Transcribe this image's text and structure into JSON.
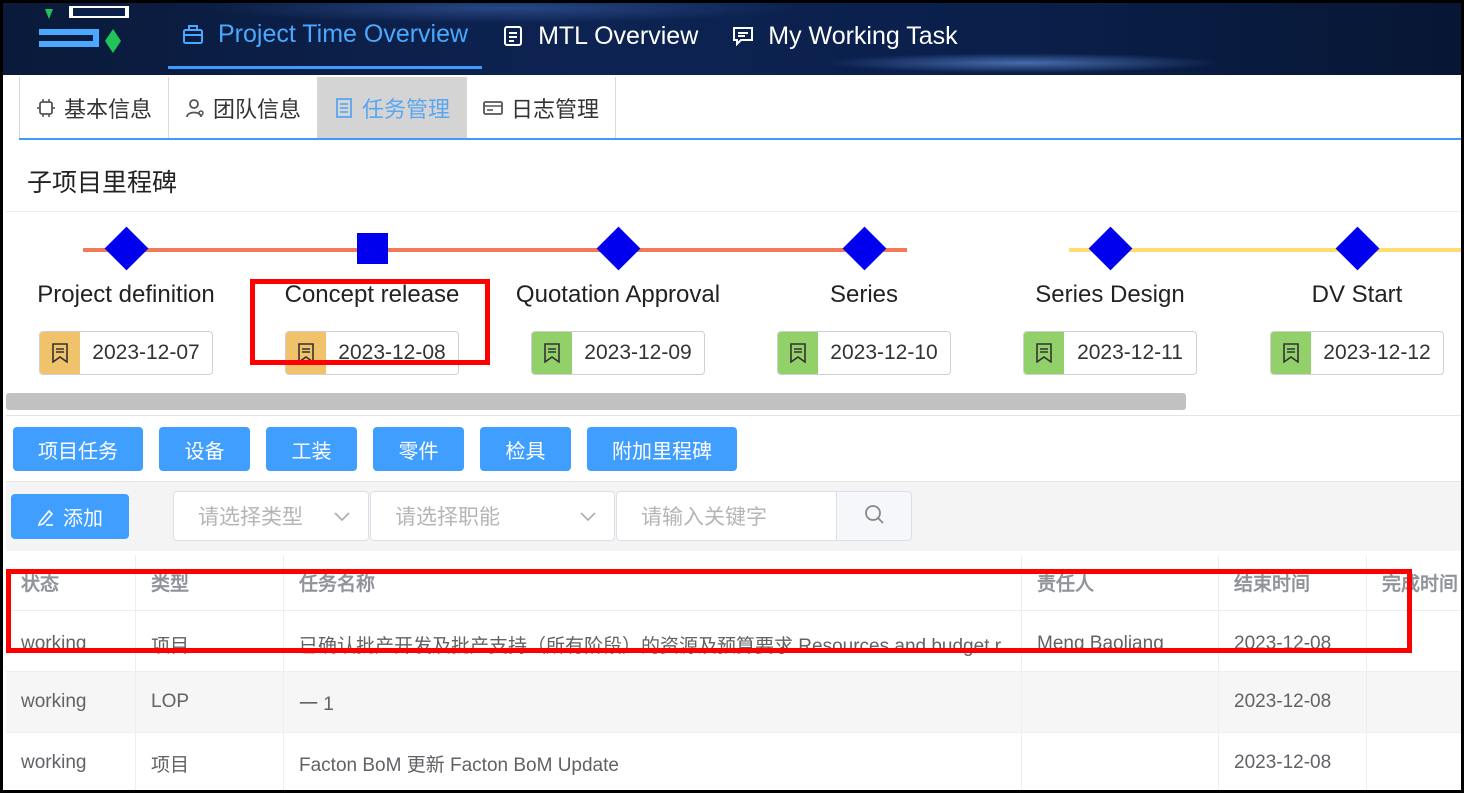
{
  "header": {
    "nav": [
      {
        "label": "Project Time Overview",
        "icon": "briefcase-icon",
        "active": true
      },
      {
        "label": "MTL Overview",
        "icon": "document-icon",
        "active": false
      },
      {
        "label": "My Working Task",
        "icon": "chat-icon",
        "active": false
      }
    ]
  },
  "tabs": [
    {
      "label": "基本信息",
      "icon": "chip-icon",
      "active": false
    },
    {
      "label": "团队信息",
      "icon": "user-icon",
      "active": false
    },
    {
      "label": "任务管理",
      "icon": "tasks-icon",
      "active": true
    },
    {
      "label": "日志管理",
      "icon": "card-icon",
      "active": false
    }
  ],
  "milestones": {
    "title": "子项目里程碑",
    "items": [
      {
        "name": "Project definition",
        "date": "2023-12-07",
        "marker": "diamond",
        "status_color": "#f0c26a"
      },
      {
        "name": "Concept release",
        "date": "2023-12-08",
        "marker": "square",
        "status_color": "#f0c26a"
      },
      {
        "name": "Quotation Approval",
        "date": "2023-12-09",
        "marker": "diamond",
        "status_color": "#92d06a"
      },
      {
        "name": "Series",
        "date": "2023-12-10",
        "marker": "diamond",
        "status_color": "#92d06a"
      },
      {
        "name": "Series Design",
        "date": "2023-12-11",
        "marker": "diamond",
        "status_color": "#92d06a"
      },
      {
        "name": "DV Start",
        "date": "2023-12-12",
        "marker": "diamond",
        "status_color": "#92d06a"
      }
    ],
    "line_colors": {
      "first_group": "#f27a5a",
      "second_group": "#fddc70"
    }
  },
  "type_buttons": [
    "项目任务",
    "设备",
    "工装",
    "零件",
    "检具",
    "附加里程碑"
  ],
  "toolbar": {
    "add_label": "添加",
    "type_placeholder": "请选择类型",
    "role_placeholder": "请选择职能",
    "keyword_placeholder": "请输入关键字"
  },
  "table": {
    "headers": [
      "状态",
      "类型",
      "任务名称",
      "责任人",
      "结束时间",
      "完成时间"
    ],
    "rows": [
      [
        "working",
        "项目",
        "已确认批产开发及批产支持（所有阶段）的资源及预算要求 Resources and budget requirement",
        "Meng Baoliang",
        "2023-12-08",
        ""
      ],
      [
        "working",
        "LOP",
        "一 1",
        "",
        "2023-12-08",
        ""
      ],
      [
        "working",
        "项目",
        "Facton BoM 更新 Facton BoM Update",
        "",
        "2023-12-08",
        ""
      ]
    ]
  },
  "colors": {
    "accent": "#409eff",
    "highlight": "#ff0000",
    "header_bg": "#0d2352"
  }
}
